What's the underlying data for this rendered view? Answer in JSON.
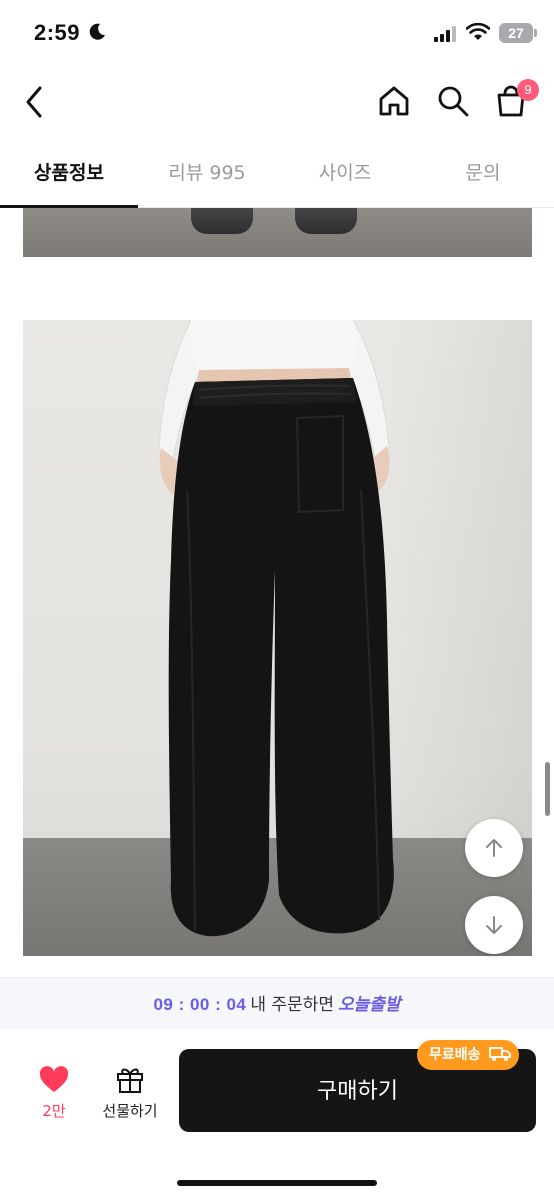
{
  "status_bar": {
    "time": "2:59",
    "battery": "27"
  },
  "nav": {
    "cart_count": "9"
  },
  "tabs": [
    {
      "label": "상품정보",
      "active": true
    },
    {
      "label": "리뷰 995",
      "active": false
    },
    {
      "label": "사이즈",
      "active": false
    },
    {
      "label": "문의",
      "active": false
    }
  ],
  "promo": {
    "timer": "09 : 00 : 04",
    "text": "내 주문하면",
    "highlight": "오늘출발"
  },
  "action_bar": {
    "like_count": "2만",
    "gift_label": "선물하기",
    "buy_label": "구매하기",
    "free_shipping_badge": "무료배송"
  },
  "colors": {
    "accent": "#6c5ce7",
    "heart": "#ff3b5c",
    "badge": "#ff9a1f",
    "buy_button": "#151515"
  }
}
